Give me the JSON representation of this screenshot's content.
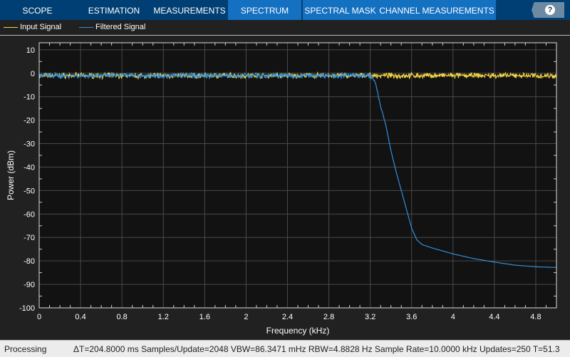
{
  "toolstrip": {
    "tabs": [
      {
        "label": "SCOPE",
        "active": false
      },
      {
        "label": "ESTIMATION",
        "active": false
      },
      {
        "label": "MEASUREMENTS",
        "active": false
      },
      {
        "label": "SPECTRUM",
        "active": true
      },
      {
        "label": "SPECTRAL MASK",
        "active": false
      },
      {
        "label": "CHANNEL MEASUREMENTS",
        "active": false
      }
    ],
    "help_label": "?"
  },
  "status": {
    "state": "Processing",
    "info": "ΔT=204.8000 ms  Samples/Update=2048  VBW=86.3471 mHz  RBW=4.8828 Hz  Sample Rate=10.0000 kHz  Updates=250  T=51.3"
  },
  "colors": {
    "input": "#f5d546",
    "filtered": "#2f8fdc",
    "plot_bg": "#121212",
    "grid": "#4a4a4a"
  },
  "chart_data": {
    "type": "line",
    "xlabel": "Frequency (kHz)",
    "ylabel": "Power (dBm)",
    "xlim": [
      0,
      5
    ],
    "ylim": [
      -100,
      13
    ],
    "xticks": [
      0,
      0.4,
      0.8,
      1.2,
      1.6,
      2,
      2.4,
      2.8,
      3.2,
      3.6,
      4,
      4.4,
      4.8
    ],
    "yticks": [
      10,
      0,
      -10,
      -20,
      -30,
      -40,
      -50,
      -60,
      -70,
      -80,
      -90,
      -100
    ],
    "grid": true,
    "legend_position": "top-left",
    "series": [
      {
        "name": "Input Signal",
        "color": "#f5d546",
        "noise_db": 1.3,
        "points": [
          [
            0,
            -1
          ],
          [
            5,
            -1
          ]
        ]
      },
      {
        "name": "Filtered Signal",
        "color": "#2f8fdc",
        "noise_db": 1.3,
        "points": [
          [
            0,
            -1
          ],
          [
            3.2,
            -1
          ],
          [
            3.25,
            -4
          ],
          [
            3.3,
            -14
          ],
          [
            3.35,
            -22
          ],
          [
            3.4,
            -33
          ],
          [
            3.45,
            -42
          ],
          [
            3.5,
            -50
          ],
          [
            3.55,
            -58
          ],
          [
            3.6,
            -66
          ],
          [
            3.65,
            -71
          ],
          [
            3.7,
            -73
          ],
          [
            3.8,
            -74.5
          ],
          [
            4,
            -77
          ],
          [
            4.2,
            -79
          ],
          [
            4.4,
            -80.5
          ],
          [
            4.6,
            -81.8
          ],
          [
            4.8,
            -82.5
          ],
          [
            5,
            -82.8
          ]
        ]
      }
    ]
  }
}
